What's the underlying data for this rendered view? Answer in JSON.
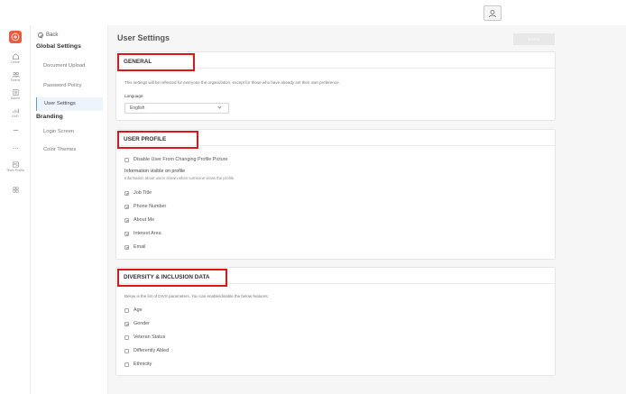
{
  "topbar": {
    "profile_icon": "user-avatar-icon"
  },
  "rail": {
    "logo_icon": "plus-circle-icon",
    "items": [
      {
        "label": "Home",
        "icon": "home-icon"
      },
      {
        "label": "Teams",
        "icon": "teams-icon"
      },
      {
        "label": "Admin",
        "icon": "admin-icon"
      },
      {
        "label": "DnD",
        "icon": "chart-icon"
      },
      {
        "label": "",
        "icon": "more-icon"
      },
      {
        "label": "",
        "icon": "dots-icon"
      },
      {
        "label": "Team Profile",
        "icon": "team-profile-icon"
      },
      {
        "label": "",
        "icon": "grid-icon"
      }
    ]
  },
  "nav": {
    "back_label": "Back",
    "section_global": "Global Settings",
    "items_global": [
      "Document Upload",
      "Password Policy",
      "User Settings"
    ],
    "active_item": "User Settings",
    "section_branding": "Branding",
    "items_branding": [
      "Login Screen",
      "Color Themes"
    ]
  },
  "main": {
    "title": "User Settings",
    "save_label": "SAVE"
  },
  "general": {
    "title": "GENERAL",
    "description": "This settings will be reflected for everyone the organization, except for those who have already set their own preference.",
    "language_label": "Language",
    "language_value": "English"
  },
  "user_profile": {
    "title": "USER PROFILE",
    "disable_picture_label": "Disable User From Changing Profile Picture",
    "visible_heading": "Information visible on profile",
    "visible_desc": "Information about users shown when someone views the profile",
    "fields": [
      {
        "label": "Job Title",
        "checked": true
      },
      {
        "label": "Phone Number",
        "checked": true
      },
      {
        "label": "About Me",
        "checked": true
      },
      {
        "label": "Interest Area",
        "checked": true
      },
      {
        "label": "Email",
        "checked": true
      }
    ]
  },
  "dni": {
    "title": "DIVERSITY & INCLUSION DATA",
    "description": "Below is the list of DIVS parameters. You can enable/disable the below features:",
    "fields": [
      {
        "label": "Age",
        "checked": false
      },
      {
        "label": "Gender",
        "checked": true
      },
      {
        "label": "Veteran Status",
        "checked": false
      },
      {
        "label": "Differently Abled",
        "checked": false
      },
      {
        "label": "Ethnicity",
        "checked": false
      }
    ]
  }
}
